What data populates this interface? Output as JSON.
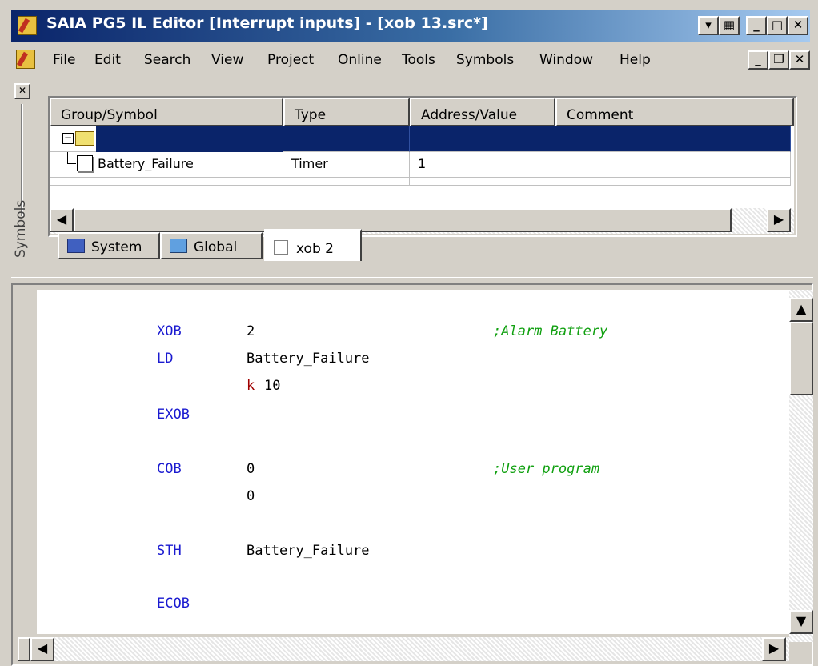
{
  "window": {
    "title": "SAIA PG5 IL Editor [Interrupt inputs] - [xob 13.src*]"
  },
  "menubar": {
    "items": [
      "File",
      "Edit",
      "Search",
      "View",
      "Project",
      "Online",
      "Tools",
      "Symbols",
      "Window",
      "Help"
    ]
  },
  "symbols": {
    "side_label": "Symbols",
    "columns": [
      "Group/Symbol",
      "Type",
      "Address/Value",
      "Comment"
    ],
    "rows": [
      {
        "symbol": "",
        "type": "",
        "address": "",
        "comment": "",
        "selected": true
      },
      {
        "symbol": "Battery_Failure",
        "type": "Timer",
        "address": "1",
        "comment": "",
        "selected": false
      }
    ],
    "tabs": [
      "System",
      "Global",
      "xob 2"
    ]
  },
  "editor": {
    "lines": [
      {
        "instr": "XOB",
        "operand": "2",
        "comment": ";Alarm Battery"
      },
      {
        "instr": "LD",
        "operand": "Battery_Failure",
        "comment": ""
      },
      {
        "instr": "",
        "operand_prefix": "k",
        "operand": "10",
        "comment": ""
      },
      {
        "instr": "EXOB",
        "operand": "",
        "comment": ""
      },
      {
        "instr": "COB",
        "operand": "0",
        "comment": ";User program"
      },
      {
        "instr": "",
        "operand": "0",
        "comment": ""
      },
      {
        "instr": "STH",
        "operand": "Battery_Failure",
        "comment": ""
      },
      {
        "instr": "ECOB",
        "operand": "",
        "comment": ""
      }
    ]
  },
  "colors": {
    "title_bar": "#0a246a",
    "keyword": "#1a1ad0",
    "comment": "#10a010",
    "constant_prefix": "#a00000"
  }
}
